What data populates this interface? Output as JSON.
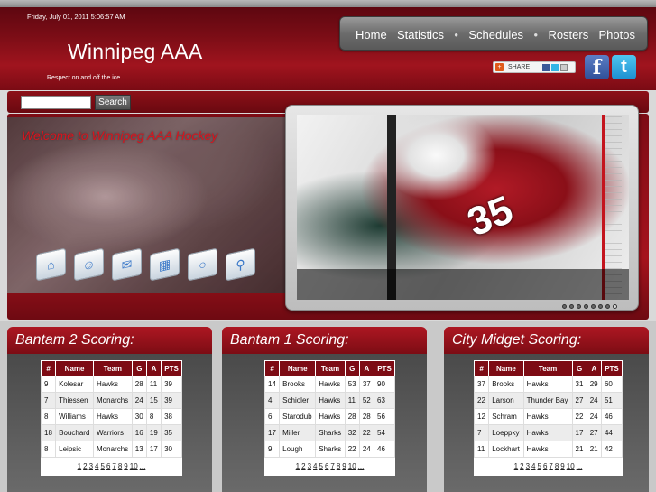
{
  "header": {
    "date": "Friday, July 01, 2011 5:06:57 AM",
    "site_title": "Winnipeg AAA",
    "tagline": "Respect on and off the ice"
  },
  "nav": {
    "items": [
      "Home",
      "Statistics",
      "Schedules",
      "Rosters",
      "Photos"
    ]
  },
  "share": {
    "label": "SHARE"
  },
  "social": {
    "facebook": "f",
    "twitter": "t"
  },
  "search": {
    "value": "",
    "button_label": "Search"
  },
  "hero": {
    "welcome": "Welcome to Winnipeg AAA Hockey",
    "jersey_number": "35",
    "slider_dots": 8
  },
  "panels": [
    {
      "title": "Bantam 2 Scoring:",
      "columns": [
        "#",
        "Name",
        "Team",
        "G",
        "A",
        "PTS"
      ],
      "rows": [
        [
          "9",
          "Kolesar",
          "Hawks",
          "28",
          "11",
          "39"
        ],
        [
          "7",
          "Thiessen",
          "Monarchs",
          "24",
          "15",
          "39"
        ],
        [
          "8",
          "Williams",
          "Hawks",
          "30",
          "8",
          "38"
        ],
        [
          "18",
          "Bouchard",
          "Warriors",
          "16",
          "19",
          "35"
        ],
        [
          "8",
          "Leipsic",
          "Monarchs",
          "13",
          "17",
          "30"
        ]
      ],
      "pages": [
        "1",
        "2",
        "3",
        "4",
        "5",
        "6",
        "7",
        "8",
        "9",
        "10",
        "..."
      ]
    },
    {
      "title": "Bantam 1 Scoring:",
      "columns": [
        "#",
        "Name",
        "Team",
        "G",
        "A",
        "PTS"
      ],
      "rows": [
        [
          "14",
          "Brooks",
          "Hawks",
          "53",
          "37",
          "90"
        ],
        [
          "4",
          "Schioler",
          "Hawks",
          "11",
          "52",
          "63"
        ],
        [
          "6",
          "Starodub",
          "Hawks",
          "28",
          "28",
          "56"
        ],
        [
          "17",
          "Miller",
          "Sharks",
          "32",
          "22",
          "54"
        ],
        [
          "9",
          "Lough",
          "Sharks",
          "22",
          "24",
          "46"
        ]
      ],
      "pages": [
        "1",
        "2",
        "3",
        "4",
        "5",
        "6",
        "7",
        "8",
        "9",
        "10",
        "..."
      ]
    },
    {
      "title": "City Midget Scoring:",
      "columns": [
        "#",
        "Name",
        "Team",
        "G",
        "A",
        "PTS"
      ],
      "rows": [
        [
          "37",
          "Brooks",
          "Hawks",
          "31",
          "29",
          "60"
        ],
        [
          "22",
          "Larson",
          "Thunder Bay",
          "27",
          "24",
          "51"
        ],
        [
          "12",
          "Schram",
          "Hawks",
          "22",
          "24",
          "46"
        ],
        [
          "7",
          "Loeppky",
          "Hawks",
          "17",
          "27",
          "44"
        ],
        [
          "11",
          "Lockhart",
          "Hawks",
          "21",
          "21",
          "42"
        ]
      ],
      "pages": [
        "1",
        "2",
        "3",
        "4",
        "5",
        "6",
        "7",
        "8",
        "9",
        "10",
        "..."
      ]
    }
  ]
}
